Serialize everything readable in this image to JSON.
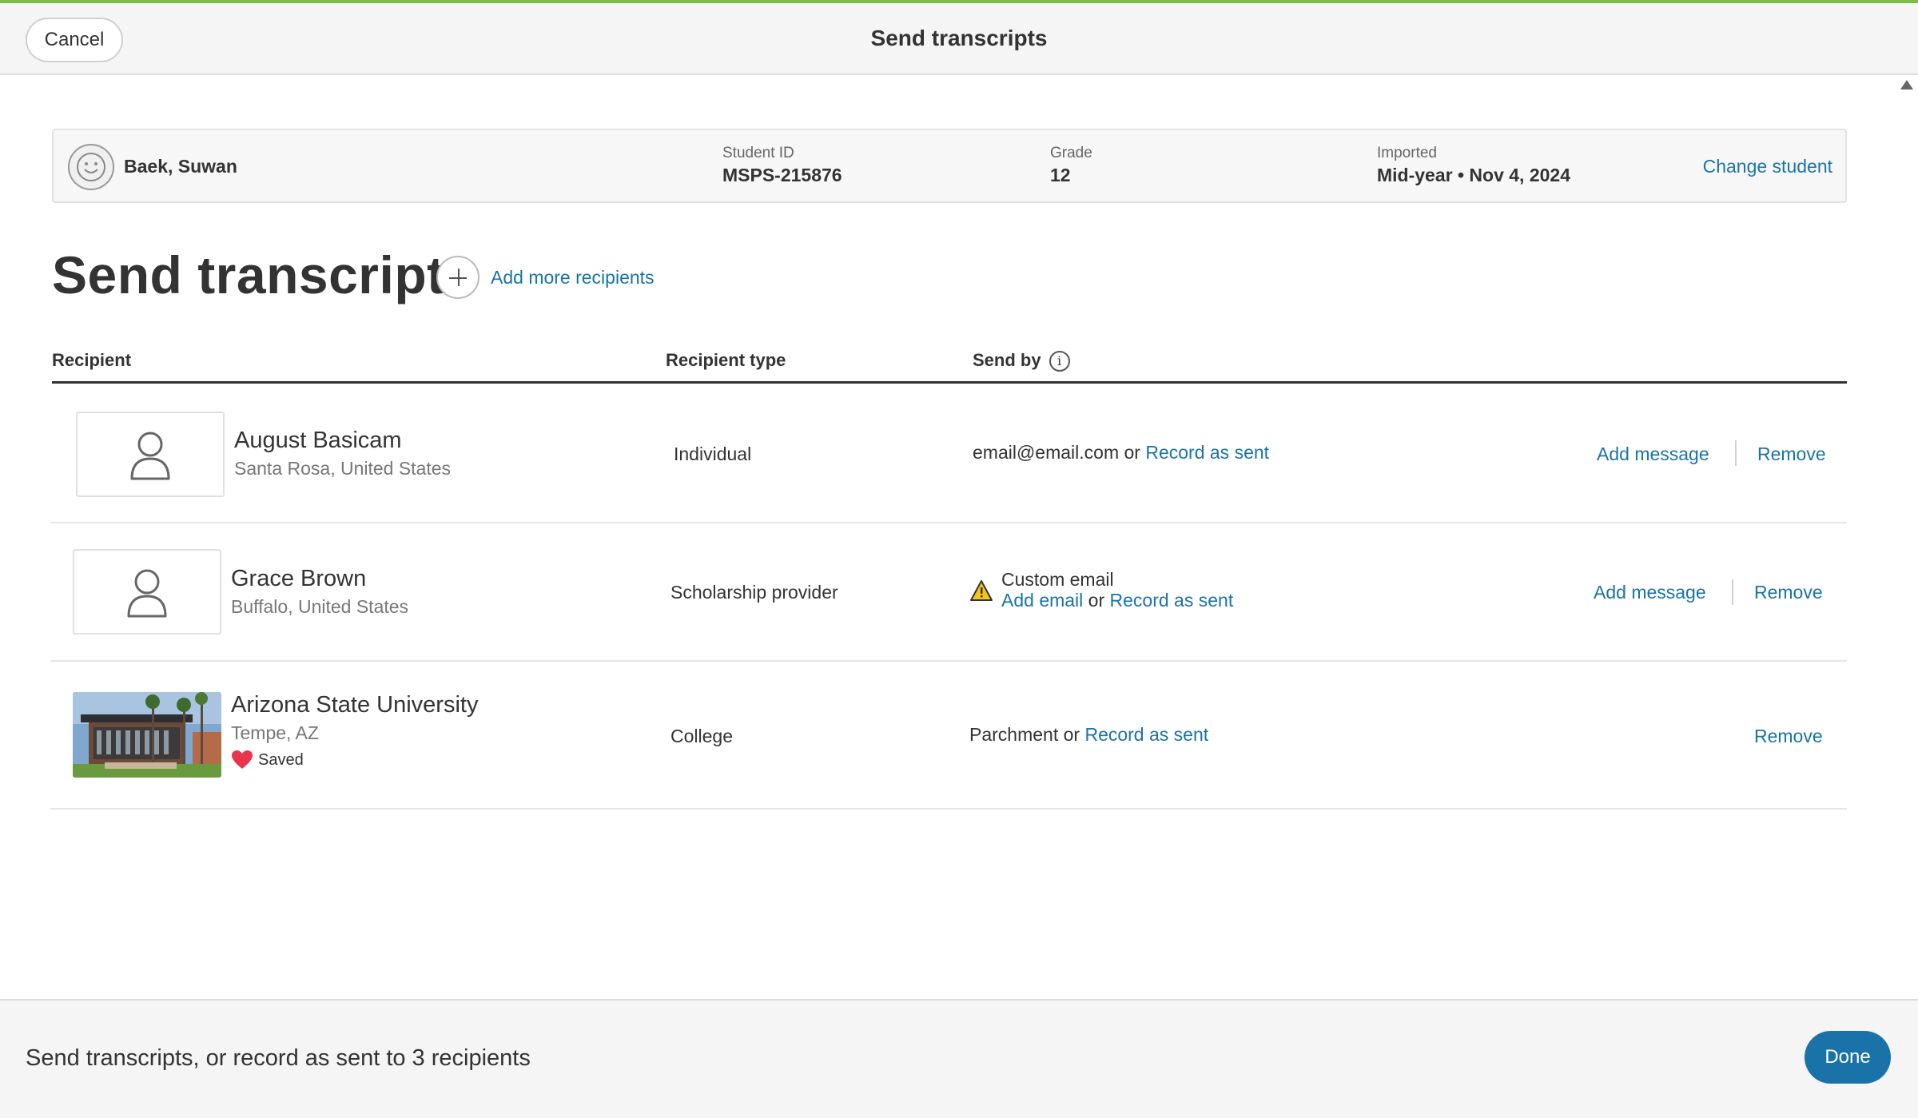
{
  "header": {
    "cancel_label": "Cancel",
    "title": "Send transcripts",
    "accent_color": "#7bc043"
  },
  "student": {
    "name": "Baek, Suwan",
    "avatar_icon": "smiley-face-icon",
    "id_label": "Student ID",
    "id_value": "MSPS-215876",
    "grade_label": "Grade",
    "grade_value": "12",
    "imported_label": "Imported",
    "imported_value": "Mid-year • Nov 4, 2024",
    "change_label": "Change student"
  },
  "page": {
    "title": "Send transcript",
    "add_recipients_label": "Add more recipients"
  },
  "table": {
    "headers": {
      "recipient": "Recipient",
      "recipient_type": "Recipient type",
      "send_by": "Send by",
      "send_by_info_icon": "info-icon"
    },
    "rows": [
      {
        "name": "August Basicam",
        "location": "Santa Rosa, United States",
        "icon": "person-icon",
        "type": "Individual",
        "send_primary": "email@email.com",
        "or": "or",
        "record_label": "Record as sent",
        "add_message_label": "Add message",
        "remove_label": "Remove"
      },
      {
        "name": "Grace Brown",
        "location": "Buffalo, United States",
        "icon": "person-icon",
        "type": "Scholarship provider",
        "warning_icon": "warning-icon",
        "send_title": "Custom email",
        "add_email_label": "Add email",
        "or": "or",
        "record_label": "Record as sent",
        "add_message_label": "Add message",
        "remove_label": "Remove"
      },
      {
        "name": "Arizona State University",
        "location": "Tempe, AZ",
        "icon": "college-photo",
        "saved_icon": "heart-icon",
        "saved_label": "Saved",
        "type": "College",
        "send_primary": "Parchment",
        "or": "or",
        "record_label": "Record as sent",
        "remove_label": "Remove"
      }
    ]
  },
  "footer": {
    "summary": "Send transcripts, or record as sent to 3 recipients",
    "done_label": "Done"
  },
  "colors": {
    "link": "#1a73a8",
    "primary_button": "#1a73a8",
    "heart": "#e8344e",
    "warning": "#f5c518"
  }
}
